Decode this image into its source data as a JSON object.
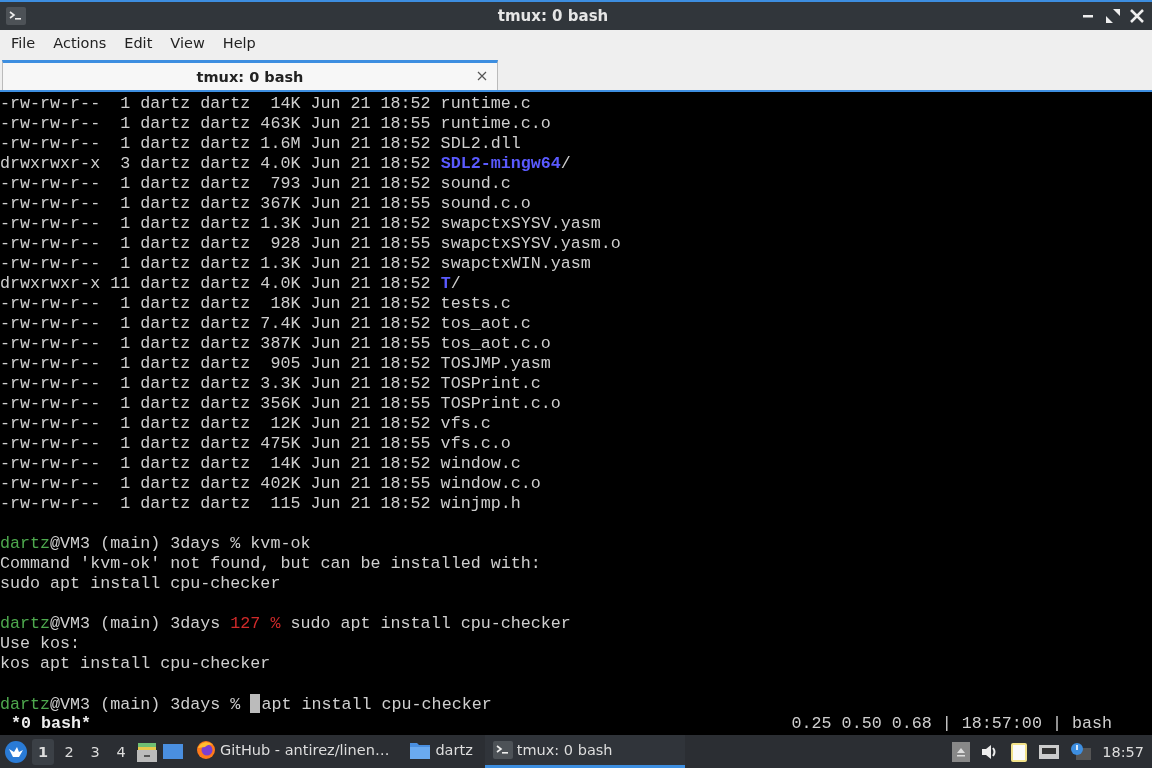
{
  "window": {
    "title": "tmux: 0 bash"
  },
  "menu": [
    "File",
    "Actions",
    "Edit",
    "View",
    "Help"
  ],
  "tabs": [
    {
      "label": "tmux: 0 bash",
      "selected": true
    }
  ],
  "terminal": {
    "lines": [
      {
        "kind": "text",
        "segments": [
          {
            "text": "-rw-rw-r--  1 dartz dartz  14K Jun 21 18:52 runtime.c",
            "kind": "plain"
          }
        ]
      },
      {
        "kind": "text",
        "segments": [
          {
            "text": "-rw-rw-r--  1 dartz dartz 463K Jun 21 18:55 runtime.c.o",
            "kind": "plain"
          }
        ]
      },
      {
        "kind": "text",
        "segments": [
          {
            "text": "-rw-rw-r--  1 dartz dartz 1.6M Jun 21 18:52 SDL2.dll",
            "kind": "plain"
          }
        ]
      },
      {
        "kind": "text",
        "segments": [
          {
            "text": "drwxrwxr-x  3 dartz dartz 4.0K Jun 21 18:52 ",
            "kind": "plain"
          },
          {
            "text": "SDL2-mingw64",
            "kind": "dir"
          },
          {
            "text": "/",
            "kind": "plain"
          }
        ]
      },
      {
        "kind": "text",
        "segments": [
          {
            "text": "-rw-rw-r--  1 dartz dartz  793 Jun 21 18:52 sound.c",
            "kind": "plain"
          }
        ]
      },
      {
        "kind": "text",
        "segments": [
          {
            "text": "-rw-rw-r--  1 dartz dartz 367K Jun 21 18:55 sound.c.o",
            "kind": "plain"
          }
        ]
      },
      {
        "kind": "text",
        "segments": [
          {
            "text": "-rw-rw-r--  1 dartz dartz 1.3K Jun 21 18:52 swapctxSYSV.yasm",
            "kind": "plain"
          }
        ]
      },
      {
        "kind": "text",
        "segments": [
          {
            "text": "-rw-rw-r--  1 dartz dartz  928 Jun 21 18:55 swapctxSYSV.yasm.o",
            "kind": "plain"
          }
        ]
      },
      {
        "kind": "text",
        "segments": [
          {
            "text": "-rw-rw-r--  1 dartz dartz 1.3K Jun 21 18:52 swapctxWIN.yasm",
            "kind": "plain"
          }
        ]
      },
      {
        "kind": "text",
        "segments": [
          {
            "text": "drwxrwxr-x 11 dartz dartz 4.0K Jun 21 18:52 ",
            "kind": "plain"
          },
          {
            "text": "T",
            "kind": "dir"
          },
          {
            "text": "/",
            "kind": "plain"
          }
        ]
      },
      {
        "kind": "text",
        "segments": [
          {
            "text": "-rw-rw-r--  1 dartz dartz  18K Jun 21 18:52 tests.c",
            "kind": "plain"
          }
        ]
      },
      {
        "kind": "text",
        "segments": [
          {
            "text": "-rw-rw-r--  1 dartz dartz 7.4K Jun 21 18:52 tos_aot.c",
            "kind": "plain"
          }
        ]
      },
      {
        "kind": "text",
        "segments": [
          {
            "text": "-rw-rw-r--  1 dartz dartz 387K Jun 21 18:55 tos_aot.c.o",
            "kind": "plain"
          }
        ]
      },
      {
        "kind": "text",
        "segments": [
          {
            "text": "-rw-rw-r--  1 dartz dartz  905 Jun 21 18:52 TOSJMP.yasm",
            "kind": "plain"
          }
        ]
      },
      {
        "kind": "text",
        "segments": [
          {
            "text": "-rw-rw-r--  1 dartz dartz 3.3K Jun 21 18:52 TOSPrint.c",
            "kind": "plain"
          }
        ]
      },
      {
        "kind": "text",
        "segments": [
          {
            "text": "-rw-rw-r--  1 dartz dartz 356K Jun 21 18:55 TOSPrint.c.o",
            "kind": "plain"
          }
        ]
      },
      {
        "kind": "text",
        "segments": [
          {
            "text": "-rw-rw-r--  1 dartz dartz  12K Jun 21 18:52 vfs.c",
            "kind": "plain"
          }
        ]
      },
      {
        "kind": "text",
        "segments": [
          {
            "text": "-rw-rw-r--  1 dartz dartz 475K Jun 21 18:55 vfs.c.o",
            "kind": "plain"
          }
        ]
      },
      {
        "kind": "text",
        "segments": [
          {
            "text": "-rw-rw-r--  1 dartz dartz  14K Jun 21 18:52 window.c",
            "kind": "plain"
          }
        ]
      },
      {
        "kind": "text",
        "segments": [
          {
            "text": "-rw-rw-r--  1 dartz dartz 402K Jun 21 18:55 window.c.o",
            "kind": "plain"
          }
        ]
      },
      {
        "kind": "text",
        "segments": [
          {
            "text": "-rw-rw-r--  1 dartz dartz  115 Jun 21 18:52 winjmp.h",
            "kind": "plain"
          }
        ]
      },
      {
        "kind": "blank"
      },
      {
        "kind": "text",
        "segments": [
          {
            "text": "dartz",
            "kind": "user"
          },
          {
            "text": "@VM3 (main) 3days % kvm-ok",
            "kind": "plain"
          }
        ]
      },
      {
        "kind": "text",
        "segments": [
          {
            "text": "Command 'kvm-ok' not found, but can be installed with:",
            "kind": "plain"
          }
        ]
      },
      {
        "kind": "text",
        "segments": [
          {
            "text": "sudo apt install cpu-checker",
            "kind": "plain"
          }
        ]
      },
      {
        "kind": "blank"
      },
      {
        "kind": "text",
        "segments": [
          {
            "text": "dartz",
            "kind": "user"
          },
          {
            "text": "@VM3 (main) 3days ",
            "kind": "plain"
          },
          {
            "text": "127 %",
            "kind": "error"
          },
          {
            "text": " sudo apt install cpu-checker",
            "kind": "plain"
          }
        ]
      },
      {
        "kind": "text",
        "segments": [
          {
            "text": "Use kos:",
            "kind": "plain"
          }
        ]
      },
      {
        "kind": "text",
        "segments": [
          {
            "text": "kos apt install cpu-checker",
            "kind": "plain"
          }
        ]
      },
      {
        "kind": "blank"
      },
      {
        "kind": "text",
        "segments": [
          {
            "text": "dartz",
            "kind": "user"
          },
          {
            "text": "@VM3 (main) 3days % ",
            "kind": "plain"
          },
          {
            "text": "apt install cpu-checker",
            "kind": "plain",
            "cursor": true
          }
        ]
      }
    ],
    "status_left": "*0 bash*",
    "status_right": "0.25 0.50 0.68 | 18:57:00 | bash"
  },
  "taskbar": {
    "workspaces": [
      {
        "label": "1",
        "selected": true
      },
      {
        "label": "2",
        "selected": false
      },
      {
        "label": "3",
        "selected": false
      },
      {
        "label": "4",
        "selected": false
      }
    ],
    "tasks": [
      {
        "label": "GitHub - antirez/linen…",
        "kind": "browser",
        "selected": false
      },
      {
        "label": "dartz",
        "kind": "folder",
        "selected": false
      },
      {
        "label": "tmux: 0 bash",
        "kind": "terminal",
        "selected": true
      }
    ],
    "clock": "18:57"
  }
}
